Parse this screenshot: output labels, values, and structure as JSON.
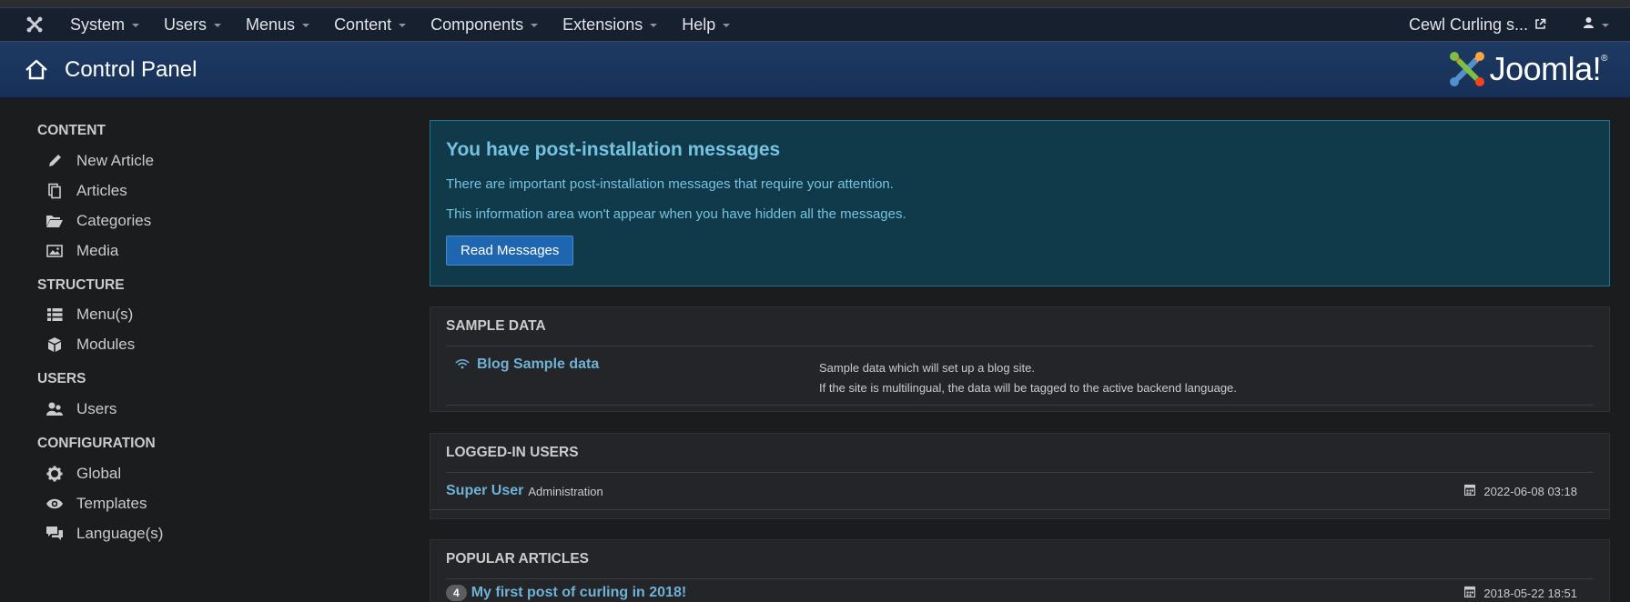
{
  "navbar": {
    "menu": [
      {
        "label": "System"
      },
      {
        "label": "Users"
      },
      {
        "label": "Menus"
      },
      {
        "label": "Content"
      },
      {
        "label": "Components"
      },
      {
        "label": "Extensions"
      },
      {
        "label": "Help"
      }
    ],
    "site_name": "Cewl Curling s...",
    "colors": {
      "background": "#17202f",
      "text": "#e1e4e8"
    }
  },
  "header": {
    "title": "Control Panel",
    "brand": "Joomla!",
    "colors": {
      "background": "#1e3a63"
    }
  },
  "sidebar": {
    "sections": [
      {
        "title": "CONTENT",
        "items": [
          {
            "label": "New Article",
            "icon": "pencil-icon"
          },
          {
            "label": "Articles",
            "icon": "copy-icon"
          },
          {
            "label": "Categories",
            "icon": "folder-open-icon"
          },
          {
            "label": "Media",
            "icon": "image-icon"
          }
        ]
      },
      {
        "title": "STRUCTURE",
        "items": [
          {
            "label": "Menu(s)",
            "icon": "list-icon"
          },
          {
            "label": "Modules",
            "icon": "cube-icon"
          }
        ]
      },
      {
        "title": "USERS",
        "items": [
          {
            "label": "Users",
            "icon": "users-icon"
          }
        ]
      },
      {
        "title": "CONFIGURATION",
        "items": [
          {
            "label": "Global",
            "icon": "gear-icon"
          },
          {
            "label": "Templates",
            "icon": "eye-icon"
          },
          {
            "label": "Language(s)",
            "icon": "comments-icon"
          }
        ]
      }
    ]
  },
  "alert": {
    "title": "You have post-installation messages",
    "line1": "There are important post-installation messages that require your attention.",
    "line2": "This information area won't appear when you have hidden all the messages.",
    "button": "Read Messages",
    "colors": {
      "background": "#10394a",
      "text": "#75c3e0",
      "button": "#1f66b1"
    }
  },
  "sample_data": {
    "title": "SAMPLE DATA",
    "items": [
      {
        "name": "Blog Sample data",
        "icon": "wifi-icon",
        "desc1": "Sample data which will set up a blog site.",
        "desc2": "If the site is multilingual, the data will be tagged to the active backend language."
      }
    ]
  },
  "logged_in": {
    "title": "LOGGED-IN USERS",
    "rows": [
      {
        "name": "Super User",
        "role": "Administration",
        "date": "2022-06-08 03:18"
      }
    ]
  },
  "popular": {
    "title": "POPULAR ARTICLES",
    "rows": [
      {
        "hits": "4",
        "title": "My first post of curling in 2018!",
        "date": "2018-05-22 18:51"
      }
    ]
  },
  "accent_link_color": "#6fb2d6"
}
